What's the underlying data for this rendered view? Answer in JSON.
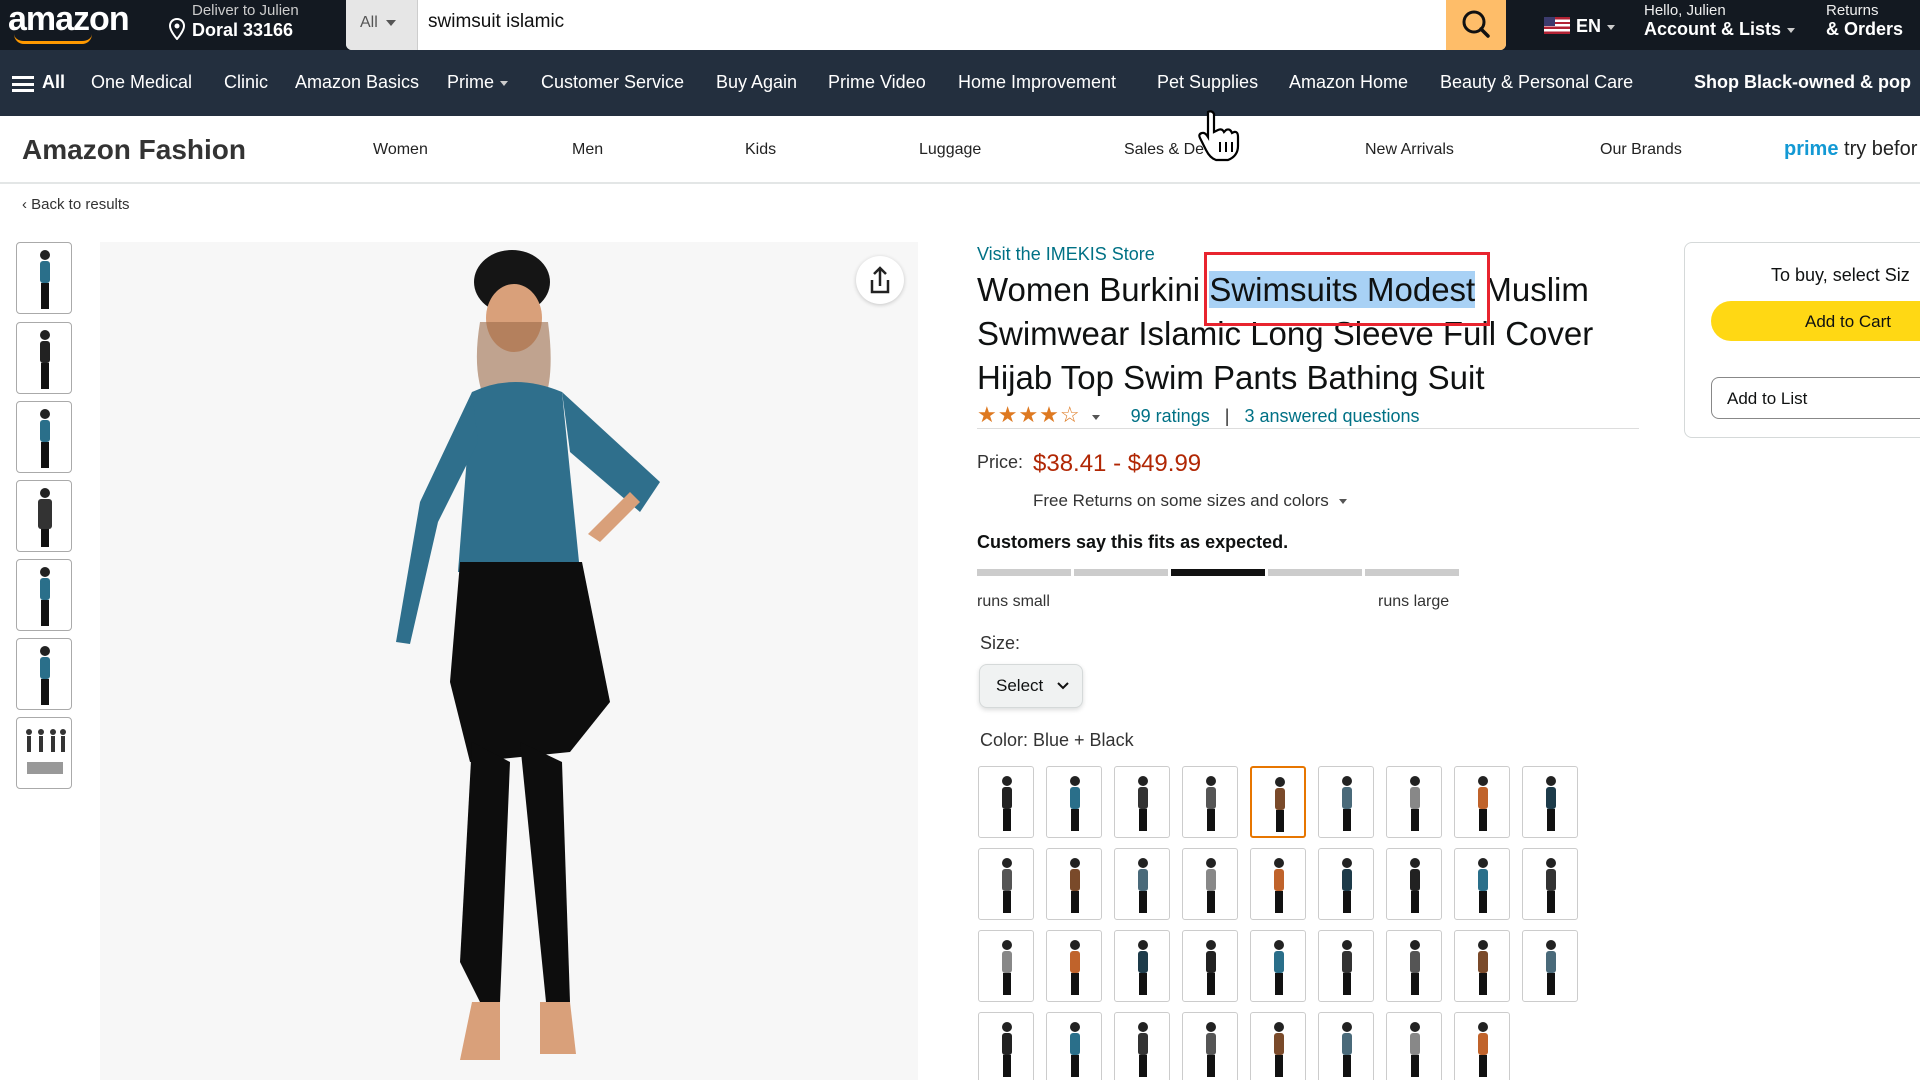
{
  "header": {
    "logo": "amazon",
    "deliver_line1": "Deliver to Julien",
    "deliver_line2": "Doral 33166",
    "search_category": "All",
    "search_value": "swimsuit islamic",
    "lang": "EN",
    "account_line1": "Hello, Julien",
    "account_line2": "Account & Lists",
    "returns_line1": "Returns",
    "returns_line2": "& Orders"
  },
  "nav": {
    "all": "All",
    "items": [
      "One Medical",
      "Clinic",
      "Amazon Basics",
      "Prime",
      "Customer Service",
      "Buy Again",
      "Prime Video",
      "Home Improvement",
      "Pet Supplies",
      "Amazon Home",
      "Beauty & Personal Care",
      "Shop Black-owned & pop"
    ]
  },
  "fashion": {
    "brand": "Amazon Fashion",
    "items": [
      "Women",
      "Men",
      "Kids",
      "Luggage",
      "Sales & De",
      "New Arrivals",
      "Our Brands"
    ],
    "prime_word": "prime",
    "prime_rest": "try befor"
  },
  "back_link": "Back to results",
  "product": {
    "store_link": "Visit the IMEKIS Store",
    "title_before": "Women Burkini ",
    "title_highlight": "Swimsuits Modest",
    "title_after": " Muslim Swimwear Islamic Long Sleeve Full Cover Hijab Top Swim Pants Bathing Suit",
    "stars": "★★★★☆",
    "ratings": "99 ratings",
    "separator": "|",
    "questions": "3 answered questions",
    "price_label": "Price:",
    "price": "$38.41 - $49.99",
    "returns": "Free Returns on some sizes and colors",
    "fit_text": "Customers say this fits as expected.",
    "fit_small": "runs small",
    "fit_large": "runs large",
    "size_label": "Size:",
    "size_select": "Select",
    "color_label": "Color: Blue + Black"
  },
  "buybox": {
    "title": "To buy, select Siz",
    "add_to_cart": "Add to Cart",
    "add_to_list": "Add to List"
  },
  "colors": {
    "header_bg": "#131921",
    "nav_bg": "#232f3e",
    "search_button": "#febd69",
    "cart_button": "#ffd814",
    "price": "#b12704",
    "link": "#007185",
    "highlight_box": "#e8242f"
  }
}
